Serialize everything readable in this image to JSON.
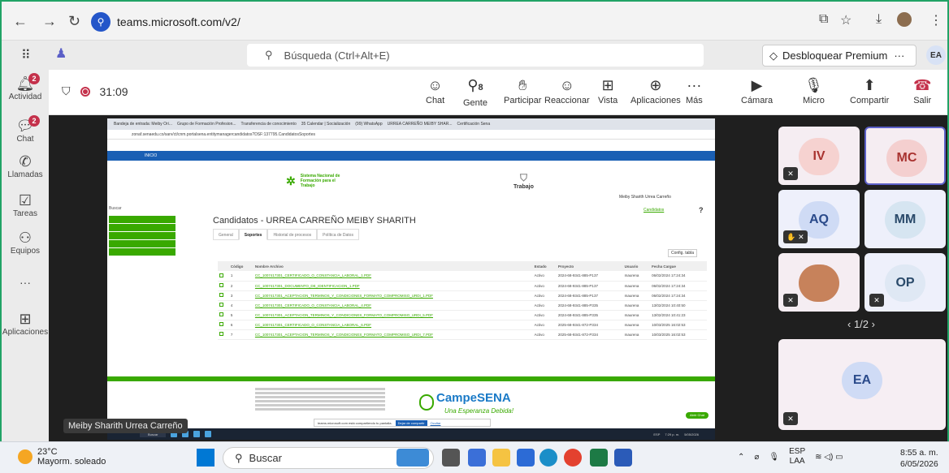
{
  "browser": {
    "url": "teams.microsoft.com/v2/"
  },
  "teams_header": {
    "search_placeholder": "Búsqueda (Ctrl+Alt+E)",
    "premium_label": "Desbloquear Premium",
    "more": "···",
    "user_initials": "EA"
  },
  "rail": {
    "items": [
      {
        "label": "Actividad",
        "badge": "2"
      },
      {
        "label": "Chat",
        "badge": "2"
      },
      {
        "label": "Llamadas"
      },
      {
        "label": "Tareas"
      },
      {
        "label": "Equipos"
      },
      {
        "label": "···"
      },
      {
        "label": "Aplicaciones"
      }
    ]
  },
  "meeting": {
    "timer": "31:09",
    "people_count": "8",
    "toolbar": {
      "chat": "Chat",
      "people": "Gente",
      "raise": "Participar",
      "react": "Reaccionar",
      "view": "Vista",
      "apps": "Aplicaciones",
      "more": "Más",
      "camera": "Cámara",
      "mic": "Micro",
      "share": "Compartir",
      "leave": "Salir"
    },
    "presenter": "Meiby Sharith Urrea Carreño",
    "gallery": {
      "tiles": [
        "IV",
        "MC",
        "AQ",
        "MM",
        "OP",
        "EA"
      ],
      "pager": "1/2"
    }
  },
  "shared_screen": {
    "tabs": [
      "Bandeja de entrada: Meiby Ori...",
      "Grupo de Formación Profesion...",
      "Transferencia de conocimiento",
      "35 Calendar | Socialización",
      "(99) WhatsApp",
      "URREA CARREÑO MEIBY SHAR...",
      "Certificación Sena"
    ],
    "url": "zonaf.senaedu.co/sarv/ct/cnm.portalsena.entitymanagercandidatos?DSF:137795.CandidatosSoportes",
    "inicio": "INICIO",
    "sena_title": "Sistema Nacional de Formación para el Trabajo",
    "trabajo": "Trabajo",
    "user_name": "Meiby Sharith Urrea Carreño",
    "candidatos_link": "Candidatos",
    "buscar": "Buscar",
    "page_title": "Candidatos - URREA CARREÑO MEIBY SHARITH",
    "subtabs": [
      "General",
      "Soportes",
      "Historial de procesos",
      "Política de Datos"
    ],
    "config": "Config. tabla",
    "table": {
      "headers": [
        "",
        "Código",
        "Nombre Archivo",
        "Estado",
        "Proyecto",
        "Usuario",
        "Fecha Cargue"
      ],
      "rows": [
        [
          "1",
          "CC_1007417301_CERTIFICADO_O_CONSTANCIA_LABORAL_1.PDF",
          "Activo",
          "2024-68-9341-885-P137",
          "maurena",
          "06/02/2024 17:24:34"
        ],
        [
          "2",
          "CC_1007417301_DOCUMENTO_DE_IDENTIFICACION_1.PDF",
          "Activo",
          "2024-68-9341-885-P137",
          "maurena",
          "06/02/2024 17:24:34"
        ],
        [
          "3",
          "CC_1007417301_ACEPTACION_TERMINOS_Y_CONDICIONES_FORMATO_COMPROMISO_URDI_1.PDF",
          "Activo",
          "2024-68-9341-885-P137",
          "maurena",
          "06/02/2024 17:24:34"
        ],
        [
          "4",
          "CC_1007417301_CERTIFICADO_O_CONSTANCIA_LABORAL_4.PDF",
          "Activo",
          "2024-68-9341-885-P335",
          "maurena",
          "13/02/2024 10:40:50"
        ],
        [
          "5",
          "CC_1007417301_ACEPTACION_TERMINOS_Y_CONDICIONES_FORMATO_COMPROMISO_URDI_5.PDF",
          "Activo",
          "2024-68-9341-885-P335",
          "maurena",
          "13/02/2024 10:41:23"
        ],
        [
          "6",
          "CC_1007417301_CERTIFICADO_O_CONSTANCIA_LABORAL_6.PDF",
          "Activo",
          "2025-68-9341-872-P334",
          "maurena",
          "10/03/2025 16:02:53"
        ],
        [
          "7",
          "CC_1007417301_ACEPTACION_TERMINOS_Y_CONDICIONES_FORMATO_COMPROMISO_URDI_7.PDF",
          "Activo",
          "2025-68-9341-872-P334",
          "maurena",
          "10/03/2025 16:02:53"
        ]
      ]
    },
    "campe": "CampeSENA",
    "esperanza": "Una Esperanza Debida!",
    "chat_btn": "Abrir Chat",
    "sharing_msg": "teams.microsoft.com está compartiendo tu pantalla.",
    "stop_share": "Dejar de compartir",
    "hide": "Ocultar",
    "taskbar_search": "Buscar",
    "taskbar_time": "7:29 p. m.",
    "taskbar_date": "5/05/2026",
    "taskbar_lang": "ESP"
  },
  "windows": {
    "temperature": "23°C",
    "weather": "Mayorm. soleado",
    "search": "Buscar",
    "lang": "ESP",
    "lang2": "LAA",
    "time": "8:55 a. m.",
    "date": "6/05/2026"
  }
}
